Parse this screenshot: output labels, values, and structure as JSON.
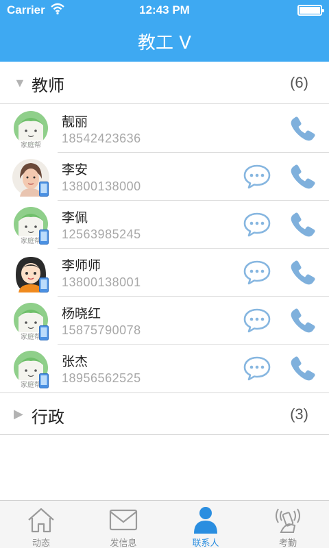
{
  "status_bar": {
    "carrier": "Carrier",
    "time": "12:43 PM"
  },
  "nav": {
    "title": "教工 V"
  },
  "groups": [
    {
      "name": "教师",
      "count": "(6)",
      "expanded": true
    },
    {
      "name": "行政",
      "count": "(3)",
      "expanded": false
    }
  ],
  "contacts": [
    {
      "name": "靓丽",
      "phone": "18542423636",
      "avatar": "default-avatar-icon",
      "message": false
    },
    {
      "name": "李安",
      "phone": "13800138000",
      "avatar": "photo-avatar",
      "message": true
    },
    {
      "name": "李佩",
      "phone": "12563985245",
      "avatar": "default-avatar-icon",
      "message": true
    },
    {
      "name": "李师师",
      "phone": "13800138001",
      "avatar": "cartoon-avatar",
      "message": true
    },
    {
      "name": "杨晓红",
      "phone": "15875790078",
      "avatar": "default-avatar-icon",
      "message": true
    },
    {
      "name": "张杰",
      "phone": "18956562525",
      "avatar": "default-avatar-icon",
      "message": true
    }
  ],
  "tabs": [
    {
      "label": "动态",
      "icon": "home-icon",
      "active": false
    },
    {
      "label": "发信息",
      "icon": "envelope-icon",
      "active": false
    },
    {
      "label": "联系人",
      "icon": "person-icon",
      "active": true
    },
    {
      "label": "考勤",
      "icon": "signal-hand-icon",
      "active": false
    }
  ],
  "colors": {
    "header": "#3ea9f2",
    "active_tab": "#2a8ee0",
    "icon_blue": "#7fb0dc"
  }
}
